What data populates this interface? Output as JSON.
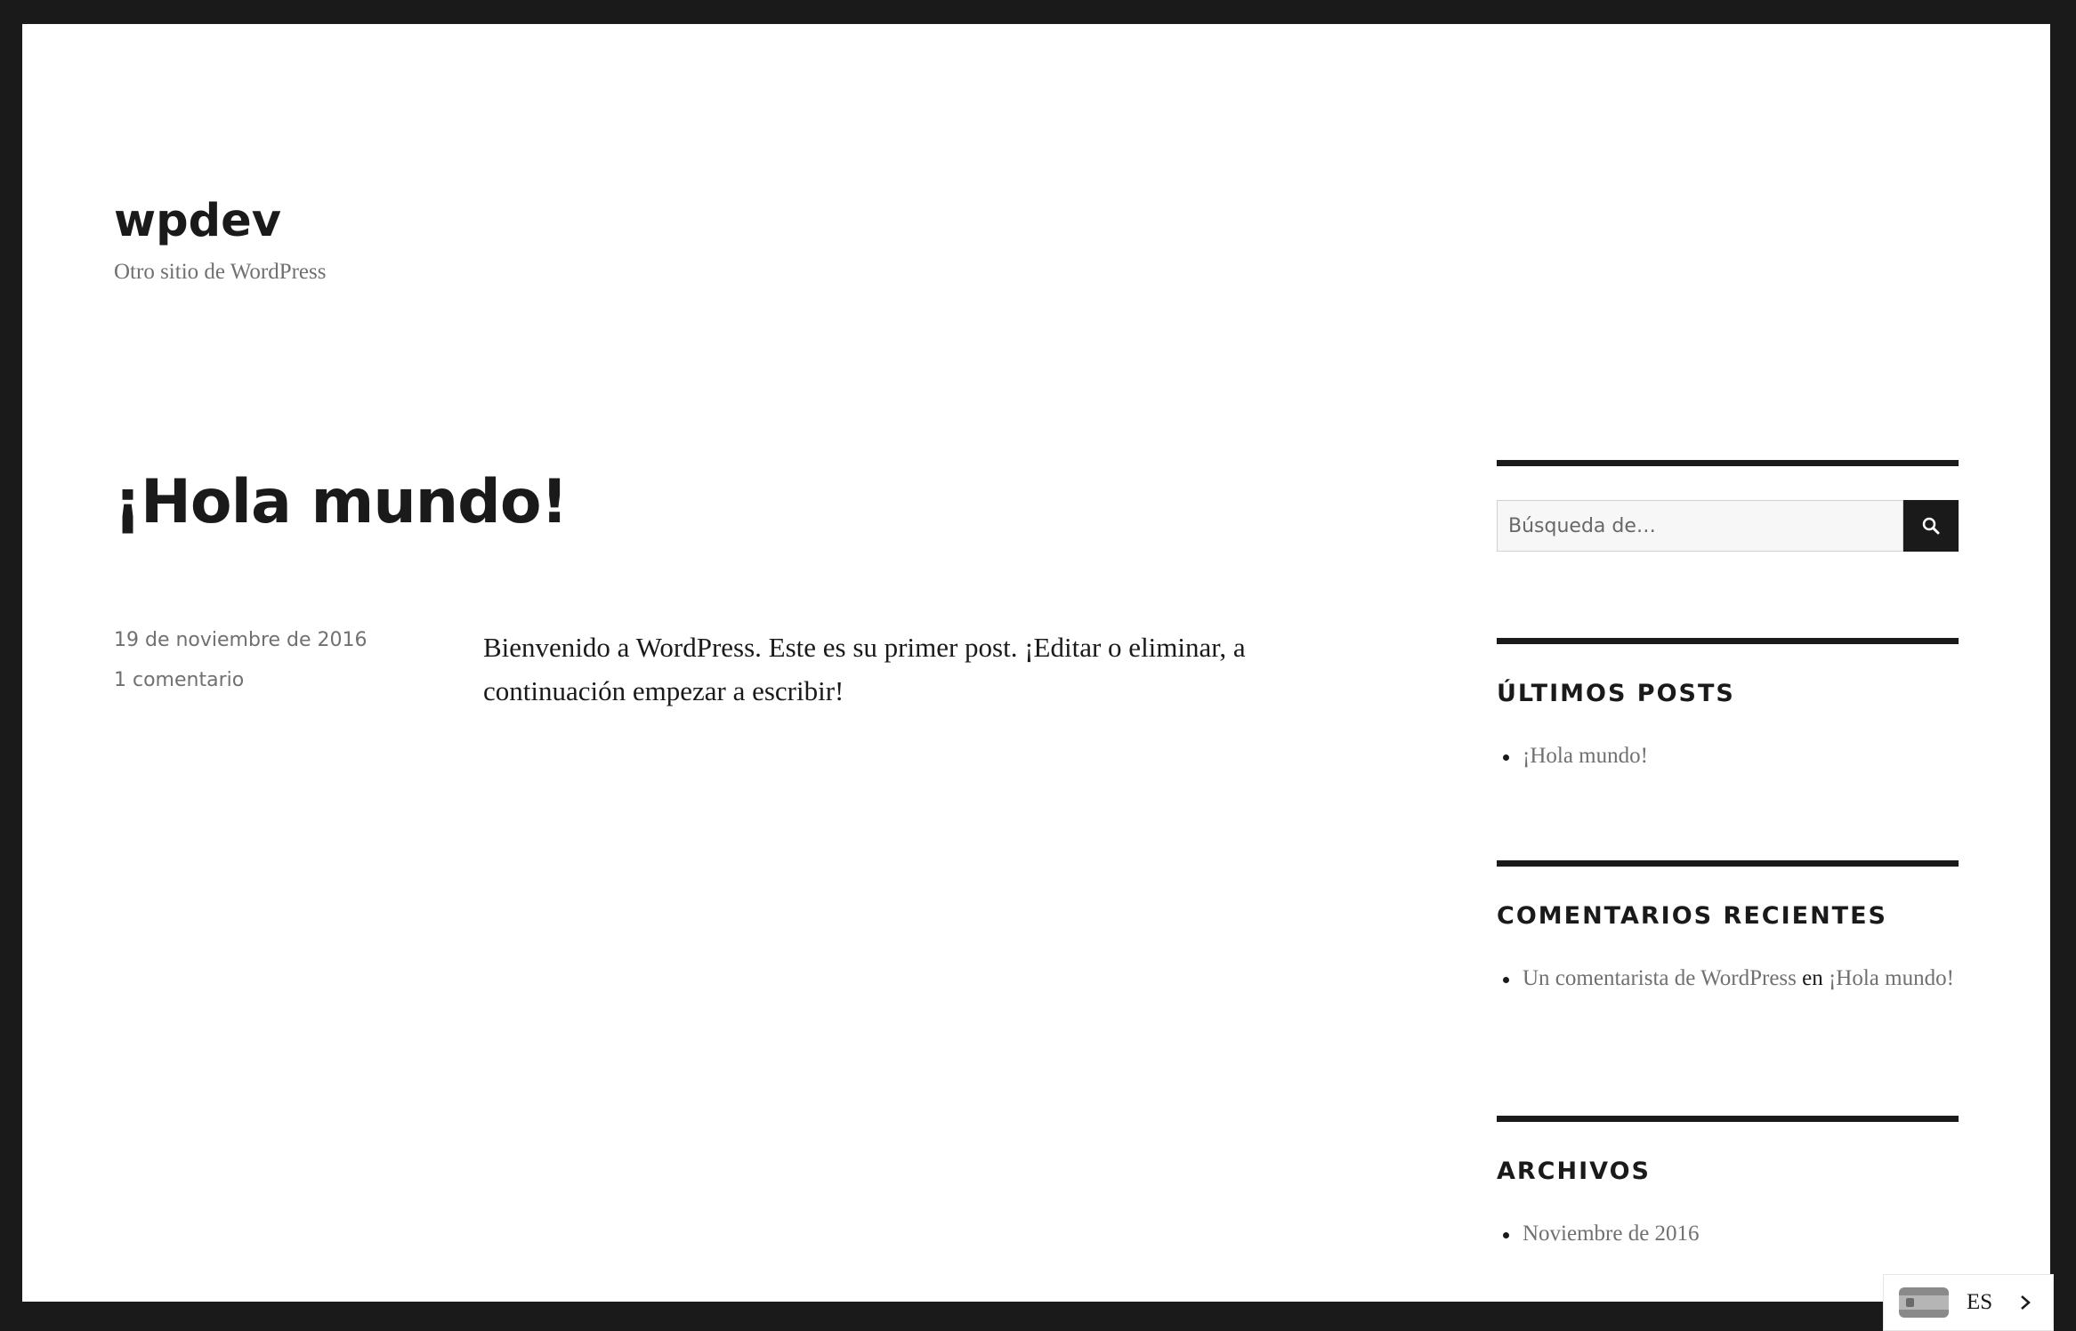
{
  "site": {
    "title": "wpdev",
    "description": "Otro sitio de WordPress"
  },
  "post": {
    "title": "¡Hola mundo!",
    "date": "19 de noviembre de 2016",
    "comments": "1 comentario",
    "content": "Bienvenido a WordPress. Este es su primer post. ¡Editar o eliminar, a continuación empezar a escribir!"
  },
  "sidebar": {
    "search": {
      "placeholder": "Búsqueda de…",
      "icon": "search-icon"
    },
    "recent_posts": {
      "title": "Últimos posts",
      "items": [
        "¡Hola mundo!"
      ]
    },
    "recent_comments": {
      "title": "Comentarios recientes",
      "author": "Un comentarista de WordPress",
      "connector": "en",
      "post": "¡Hola mundo!"
    },
    "archives": {
      "title": "Archivos",
      "items": [
        "Noviembre de 2016"
      ]
    }
  },
  "language_switcher": {
    "code": "ES",
    "flag_icon": "spain-flag-icon",
    "arrow_icon": "chevron-right-icon"
  },
  "colors": {
    "frame": "#1a1a1a",
    "text": "#1a1a1a",
    "muted": "#707070"
  }
}
